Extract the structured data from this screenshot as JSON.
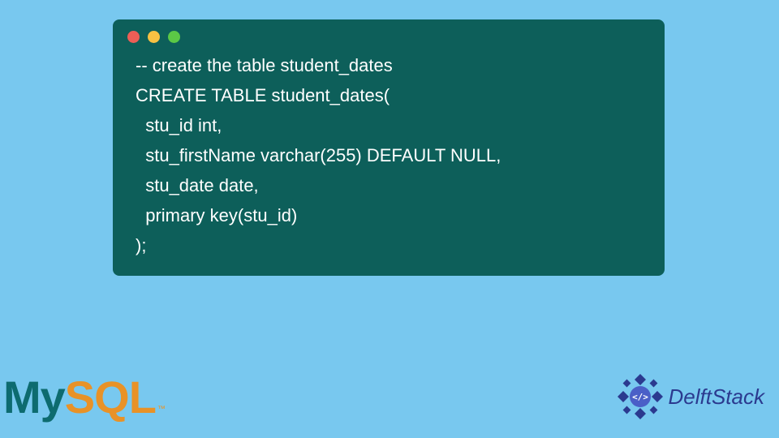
{
  "code": {
    "lines": [
      "-- create the table student_dates",
      "CREATE TABLE student_dates(",
      "  stu_id int,",
      "  stu_firstName varchar(255) DEFAULT NULL,",
      "  stu_date date,",
      "  primary key(stu_id)",
      ");"
    ]
  },
  "logo_mysql": {
    "part1": "My",
    "part2": "SQL",
    "tm": "™"
  },
  "logo_delft": {
    "text": "DelftStack",
    "icon_glyph": "</>"
  },
  "colors": {
    "bg": "#78c8ef",
    "code_bg": "#0d5f5a",
    "mysql_teal": "#0d6b6f",
    "mysql_orange": "#e89227",
    "delft_blue": "#2b3a8f"
  }
}
